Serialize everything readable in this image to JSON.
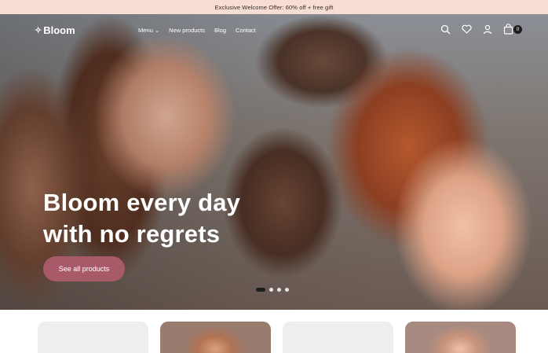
{
  "announcement": "Exclusive Welcome Offer: 60% off + free gift",
  "header": {
    "logo": "Bloom",
    "nav": [
      "Menu",
      "New products",
      "Blog",
      "Contact"
    ],
    "cart_count": "0"
  },
  "hero": {
    "headline_line1": "Bloom every day",
    "headline_line2": "with no regrets",
    "cta_label": "See all products",
    "slide_count": 4,
    "active_slide": 1
  },
  "colors": {
    "announcement_bg": "#f6ded4",
    "cta_bg": "#a95a69",
    "text_light": "#ffffff"
  },
  "icons": [
    "search-icon",
    "heart-icon",
    "user-icon",
    "bag-icon",
    "chevron-down-icon",
    "sparkle-icon"
  ]
}
